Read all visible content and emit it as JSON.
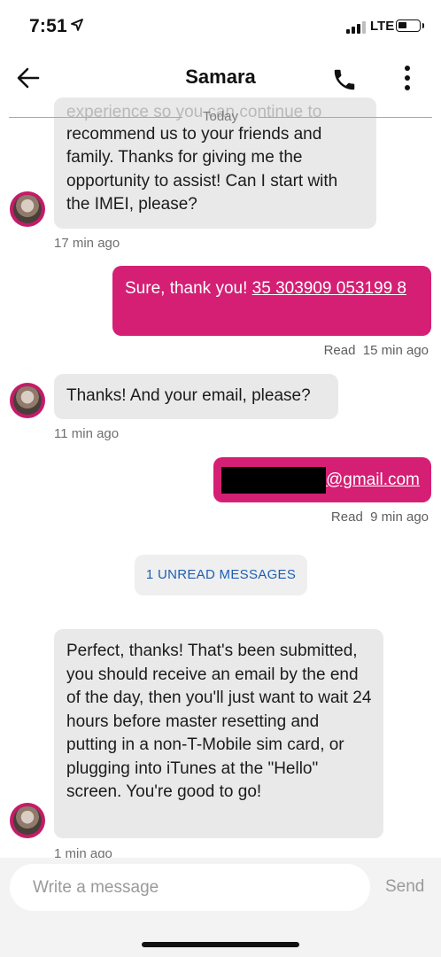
{
  "status_bar": {
    "time": "7:51",
    "network": "LTE"
  },
  "header": {
    "title": "Samara"
  },
  "chat": {
    "date_divider": "Today",
    "messages": [
      {
        "direction": "incoming",
        "text_faded": "experience so you can continue to",
        "text": "recommend us to your friends and family. Thanks for giving me the opportunity to assist! Can I start with the IMEI, please?",
        "time": "17 min ago"
      },
      {
        "direction": "outgoing",
        "text_prefix": "Sure, thank you! ",
        "link": "35 303909 053199 8",
        "read_label": "Read",
        "time": "15 min ago"
      },
      {
        "direction": "incoming",
        "text": "Thanks! And your email, please?",
        "time": "11 min ago"
      },
      {
        "direction": "outgoing",
        "email_domain": "@gmail.com",
        "read_label": "Read",
        "time": "9 min ago"
      },
      {
        "direction": "incoming",
        "text": "Perfect, thanks! That's been submitted, you should receive an email by the end of the day, then you'll just want to wait 24 hours before master resetting and putting in a non-T-Mobile sim card, or plugging into iTunes at the \"Hello\" screen. You're good to go!",
        "time": "1 min ago"
      }
    ],
    "unread_banner": "1 UNREAD MESSAGES"
  },
  "composer": {
    "placeholder": "Write a message",
    "send_label": "Send"
  },
  "colors": {
    "accent": "#d41f74",
    "incoming_bubble": "#e9e9e9",
    "unread_text": "#1d5fb5"
  }
}
